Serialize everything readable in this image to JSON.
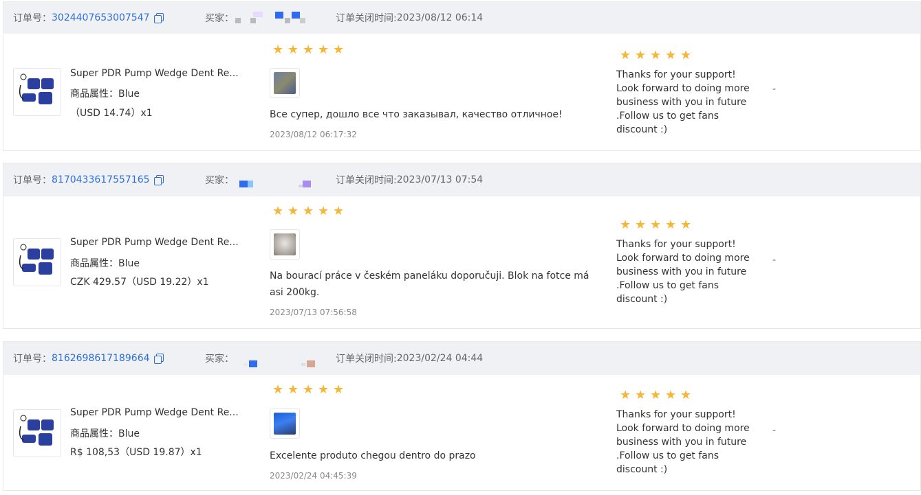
{
  "labels": {
    "order_no": "订单号：",
    "buyer": "买家：",
    "close_time_prefix": "订单关闭时间:",
    "attr_prefix": "商品属性：",
    "dash": "-"
  },
  "orders": [
    {
      "order_no": "3024407653007547",
      "close_time": "2023/08/12 06:14",
      "product_title": "Super PDR Pump Wedge Dent Re...",
      "attr_value": "Blue",
      "price": "（USD  14.74）x1",
      "rating": 5,
      "review_text": "Все супер, дошло все что заказывал, качество отличное!",
      "review_time": "2023/08/12 06:17:32",
      "seller_rating": 5,
      "reply": "Thanks for your support! Look forward to doing more business with you in future .Follow us to get fans discount :)"
    },
    {
      "order_no": "8170433617557165",
      "close_time": "2023/07/13 07:54",
      "product_title": "Super PDR Pump Wedge Dent Re...",
      "attr_value": "Blue",
      "price": "CZK 429.57（USD  19.22）x1",
      "rating": 5,
      "review_text": "Na bourací práce v českém paneláku doporučuji. Blok na fotce má asi 200kg.",
      "review_time": "2023/07/13 07:56:58",
      "seller_rating": 5,
      "reply": "Thanks for your support! Look forward to doing more business with you in future .Follow us to get fans discount :)"
    },
    {
      "order_no": "8162698617189664",
      "close_time": "2023/02/24 04:44",
      "product_title": "Super PDR Pump Wedge Dent Re...",
      "attr_value": "Blue",
      "price": "R$ 108,53（USD  19.87）x1",
      "rating": 5,
      "review_text": "Excelente produto chegou dentro do prazo",
      "review_time": "2023/02/24 04:45:39",
      "seller_rating": 5,
      "reply": "Thanks for your support! Look forward to doing more business with you in future .Follow us to get fans discount :)"
    }
  ],
  "colors": {
    "accent": "#2d6fd6",
    "star": "#f7b637",
    "header_bg": "#f0f1f4"
  }
}
